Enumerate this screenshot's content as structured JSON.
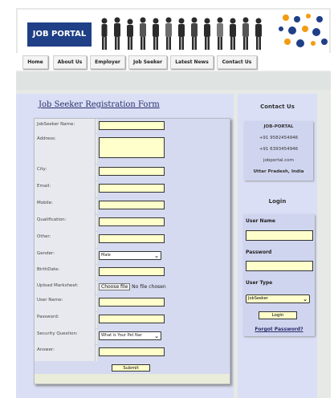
{
  "header": {
    "logo_text": "JOB PORTAL"
  },
  "nav": {
    "items": [
      "Home",
      "About Us",
      "Employer",
      "Job Seeker",
      "Latest News",
      "Contact Us"
    ]
  },
  "form": {
    "title": "Job Seeker Registration Form",
    "labels": {
      "name": "JobSeeker Name:",
      "address": "Address:",
      "city": "City:",
      "email": "Email:",
      "mobile": "Mobile:",
      "qualification": "Qualification:",
      "other": "Other:",
      "gender": "Gender:",
      "birthdate": "BirthDate:",
      "marksheet": "Upload Marksheet:",
      "username": "User Name:",
      "password": "Password:",
      "security_question": "Security Question:",
      "answer": "Answer:"
    },
    "gender_value": "Male",
    "file_button": "Choose file",
    "file_status": "No file chosen",
    "security_question_value": "What is Your Pet Nar",
    "submit_label": "Submit"
  },
  "sidebar": {
    "contact_title": "Contact Us",
    "contact": {
      "name": "JOB-PORTAL",
      "phone1": "+91 9582454946",
      "phone2": "+91 6393454946",
      "website": "jobportal.com",
      "location": "Uttar Pradesh, India"
    },
    "login_title": "Login",
    "login": {
      "user_name_label": "User Name",
      "password_label": "Password",
      "user_type_label": "User Type",
      "user_type_value": "JobSeeker",
      "login_button": "Login",
      "forgot_link": "Forgot Password?"
    }
  },
  "colors": {
    "logo_bg": "#1f3f86",
    "panel_bg": "#dadff5",
    "input_bg": "#ffffcc",
    "title_text": "#2a2f6e"
  }
}
